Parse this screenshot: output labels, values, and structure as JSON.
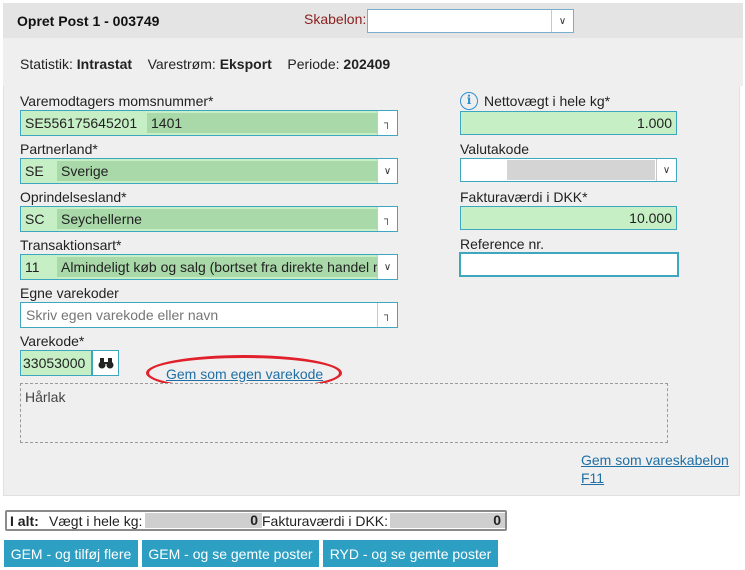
{
  "header": {
    "title": "Opret Post 1 - 003749",
    "template_label": "Skabelon:",
    "template_value": ""
  },
  "stats": {
    "statistik_label": "Statistik:",
    "statistik_value": "Intrastat",
    "varestrom_label": "Varestrøm:",
    "varestrom_value": "Eksport",
    "periode_label": "Periode:",
    "periode_value": "202409"
  },
  "form": {
    "vat": {
      "label": "Varemodtagers momsnummer*",
      "code": "SE556175645201",
      "name": "1401"
    },
    "partner": {
      "label": "Partnerland*",
      "code": "SE",
      "name": "Sverige"
    },
    "origin": {
      "label": "Oprindelsesland*",
      "code": "SC",
      "name": "Seychellerne"
    },
    "transaction": {
      "label": "Transaktionsart*",
      "code": "11",
      "name": "Almindeligt køb og salg (bortset fra direkte handel med/af private forbrugere)"
    },
    "own_code": {
      "label": "Egne varekoder",
      "placeholder": "Skriv egen varekode eller navn"
    },
    "commodity": {
      "label": "Varekode*",
      "value": "33053000"
    },
    "save_own_link": "Gem som egen varekode",
    "description": "Hårlak",
    "net_weight": {
      "label": "Nettovægt i hele kg*",
      "value": "1.000"
    },
    "currency": {
      "label": "Valutakode",
      "value": ""
    },
    "invoice": {
      "label": "Fakturaværdi i DKK*",
      "value": "10.000"
    },
    "reference": {
      "label": "Reference nr.",
      "value": ""
    },
    "save_template_link": "Gem som vareskabelon",
    "save_template_shortcut": "F11"
  },
  "totals": {
    "label": "I alt:",
    "weight_label": "Vægt i hele kg:",
    "weight_value": "0",
    "invoice_label": "Fakturaværdi i DKK:",
    "invoice_value": "0"
  },
  "buttons": {
    "save_add": "GEM - og tilføj flere",
    "save_view": "GEM - og se gemte poster",
    "clear_view": "RYD - og se gemte poster"
  },
  "icons": {
    "chevron": "double-chevron-down-icon",
    "lookup": "lookup-corner-icon",
    "binoculars": "binoculars-icon",
    "info": "info-icon"
  },
  "colors": {
    "accent": "#2d9fc2",
    "field_green": "#c6efc6",
    "highlight_red": "#e0202a",
    "link": "#1f6fa5"
  }
}
